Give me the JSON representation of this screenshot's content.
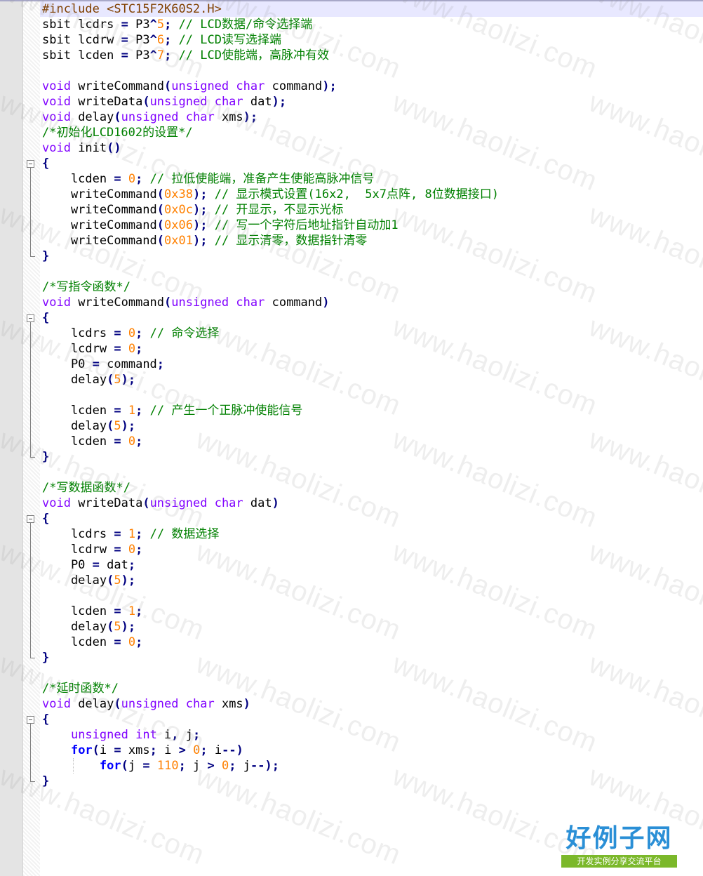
{
  "editor": {
    "lines": [
      "#include <STC15F2K60S2.H>",
      "sbit lcdrs = P3^5; // LCD数据/命令选择端",
      "sbit lcdrw = P3^6; // LCD读写选择端",
      "sbit lcden = P3^7; // LCD使能端，高脉冲有效",
      "",
      "void writeCommand(unsigned char command);",
      "void writeData(unsigned char dat);",
      "void delay(unsigned char xms);",
      "/*初始化LCD1602的设置*/",
      "void init()",
      "{",
      "    lcden = 0; // 拉低使能端，准备产生使能高脉冲信号",
      "    writeCommand(0x38); // 显示模式设置(16x2,  5x7点阵, 8位数据接口)",
      "    writeCommand(0x0c); // 开显示，不显示光标",
      "    writeCommand(0x06); // 写一个字符后地址指针自动加1",
      "    writeCommand(0x01); // 显示清零，数据指针清零",
      "}",
      "",
      "/*写指令函数*/",
      "void writeCommand(unsigned char command)",
      "{",
      "    lcdrs = 0; // 命令选择",
      "    lcdrw = 0;",
      "    P0 = command;",
      "    delay(5);",
      "",
      "    lcden = 1; // 产生一个正脉冲使能信号",
      "    delay(5);",
      "    lcden = 0;",
      "}",
      "",
      "/*写数据函数*/",
      "void writeData(unsigned char dat)",
      "{",
      "    lcdrs = 1; // 数据选择",
      "    lcdrw = 0;",
      "    P0 = dat;",
      "    delay(5);",
      "",
      "    lcden = 1;",
      "    delay(5);",
      "    lcden = 0;",
      "}",
      "",
      "/*延时函数*/",
      "void delay(unsigned char xms)",
      "{",
      "    unsigned int i, j;",
      "    for(i = xms; i > 0; i--)",
      "        for(j = 110; j > 0; j--);",
      "}"
    ]
  },
  "watermark": {
    "text": "www.haolizi.com"
  },
  "logo": {
    "title": "好例子网",
    "subtitle": "开发实例分享交流平台"
  },
  "colors": {
    "keyword": "#8000ff",
    "bold_keyword": "#0000ff",
    "number": "#ff8000",
    "comment": "#008000",
    "preprocessor": "#804000",
    "operator": "#000080",
    "current_line": "#e8e8ff",
    "logo_blue": "#2a8fd6",
    "logo_green": "#7bb82a"
  }
}
